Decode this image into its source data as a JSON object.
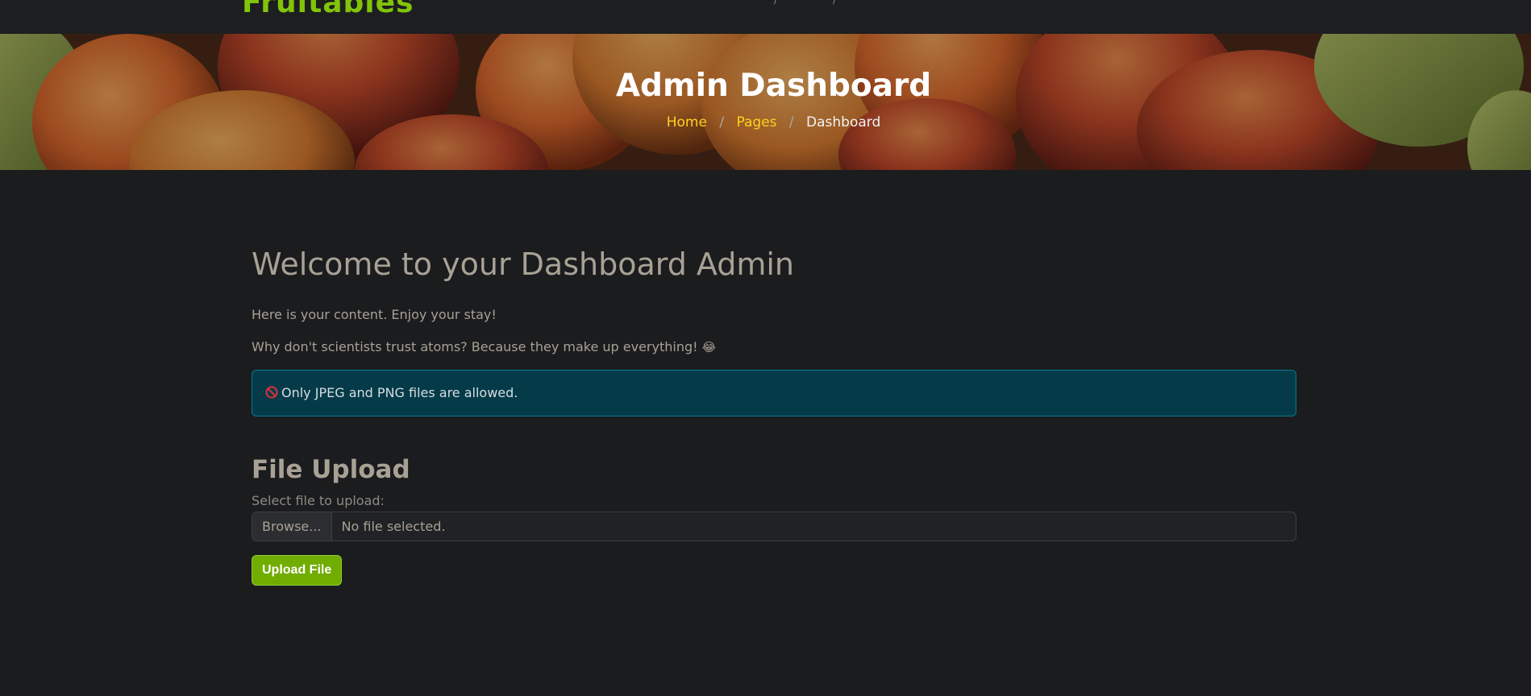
{
  "nav": {
    "logo": "Fruitables",
    "fragments": [
      "/",
      "/"
    ]
  },
  "hero": {
    "title": "Admin Dashboard",
    "breadcrumb": {
      "home": "Home",
      "pages": "Pages",
      "current": "Dashboard",
      "separator": "/"
    }
  },
  "main": {
    "welcome": "Welcome to your Dashboard Admin",
    "intro": "Here is your content. Enjoy your stay!",
    "joke": "Why don't scientists trust atoms? Because they make up everything!",
    "joke_emoji": "😂"
  },
  "alert": {
    "icon": "no-entry-icon",
    "text": "Only JPEG and PNG files are allowed.",
    "color": "#053b49"
  },
  "upload": {
    "title": "File Upload",
    "label": "Select file to upload:",
    "browse": "Browse...",
    "status": "No file selected.",
    "button": "Upload File",
    "button_color": "#71ac00"
  },
  "colors": {
    "brand": "#81c408",
    "breadcrumb_link": "#ffd21f",
    "page_bg": "#1b1c1e"
  }
}
